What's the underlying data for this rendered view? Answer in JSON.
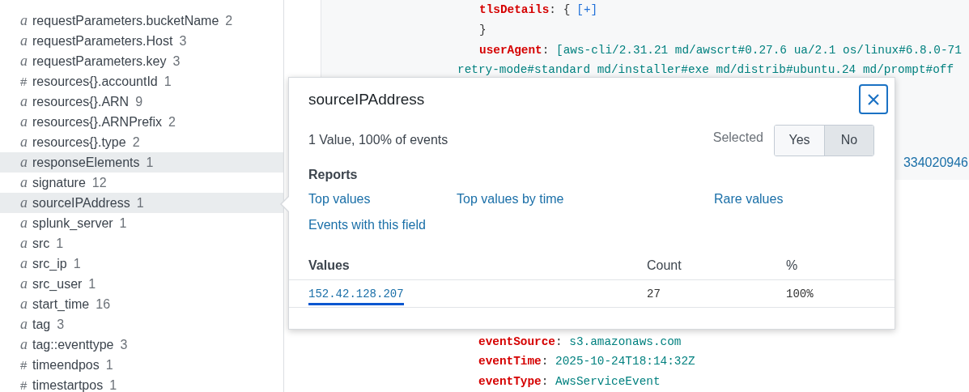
{
  "fields": [
    {
      "type": "a",
      "name": "requestParameters.bucketName",
      "count": "2",
      "highlighted": false
    },
    {
      "type": "a",
      "name": "requestParameters.Host",
      "count": "3",
      "highlighted": false
    },
    {
      "type": "a",
      "name": "requestParameters.key",
      "count": "3",
      "highlighted": false
    },
    {
      "type": "#",
      "name": "resources{}.accountId",
      "count": "1",
      "highlighted": false
    },
    {
      "type": "a",
      "name": "resources{}.ARN",
      "count": "9",
      "highlighted": false
    },
    {
      "type": "a",
      "name": "resources{}.ARNPrefix",
      "count": "2",
      "highlighted": false
    },
    {
      "type": "a",
      "name": "resources{}.type",
      "count": "2",
      "highlighted": false
    },
    {
      "type": "a",
      "name": "responseElements",
      "count": "1",
      "highlighted": true
    },
    {
      "type": "a",
      "name": "signature",
      "count": "12",
      "highlighted": false
    },
    {
      "type": "a",
      "name": "sourceIPAddress",
      "count": "1",
      "highlighted": true
    },
    {
      "type": "a",
      "name": "splunk_server",
      "count": "1",
      "highlighted": false
    },
    {
      "type": "a",
      "name": "src",
      "count": "1",
      "highlighted": false
    },
    {
      "type": "a",
      "name": "src_ip",
      "count": "1",
      "highlighted": false
    },
    {
      "type": "a",
      "name": "src_user",
      "count": "1",
      "highlighted": false
    },
    {
      "type": "a",
      "name": "start_time",
      "count": "16",
      "highlighted": false
    },
    {
      "type": "a",
      "name": "tag",
      "count": "3",
      "highlighted": false
    },
    {
      "type": "a",
      "name": "tag::eventtype",
      "count": "3",
      "highlighted": false
    },
    {
      "type": "#",
      "name": "timeendpos",
      "count": "1",
      "highlighted": false
    },
    {
      "type": "#",
      "name": "timestartpos",
      "count": "1",
      "highlighted": false
    }
  ],
  "event": {
    "top_lines": [
      {
        "kind": "expand",
        "key": "tlsDetails",
        "punct": ": {",
        "link": "[+]"
      },
      {
        "kind": "brace",
        "text": "}"
      },
      {
        "kind": "pair",
        "key": "userAgent",
        "punct": ":",
        "value": "[aws-cli/2.31.21 md/awscrt#0.27.6 ua/2.1 os/linux#6.8.0-71"
      },
      {
        "kind": "wrap",
        "text": "retry-mode#standard md/installer#exe md/distrib#ubuntu.24 md/prompt#off"
      }
    ],
    "tail": "334020946",
    "bottom_lines": [
      {
        "kind": "pair",
        "key": "eventSource",
        "punct": ":",
        "value": "s3.amazonaws.com"
      },
      {
        "kind": "pair",
        "key": "eventTime",
        "punct": ":",
        "value": "2025-10-24T18:14:32Z"
      },
      {
        "kind": "pair",
        "key": "eventType",
        "punct": ":",
        "value": "AwsServiceEvent"
      }
    ]
  },
  "popup": {
    "title": "sourceIPAddress",
    "summary": "1 Value, 100% of events",
    "selected_label": "Selected",
    "options": [
      {
        "label": "Yes",
        "selected": false
      },
      {
        "label": "No",
        "selected": true
      }
    ],
    "reports_heading": "Reports",
    "reports": [
      "Top values",
      "Top values by time",
      "Rare values",
      "Events with this field"
    ],
    "columns": [
      "Values",
      "Count",
      "%"
    ],
    "rows": [
      {
        "value": "152.42.128.207",
        "count": "27",
        "percent": "100%",
        "selected": true
      }
    ]
  }
}
